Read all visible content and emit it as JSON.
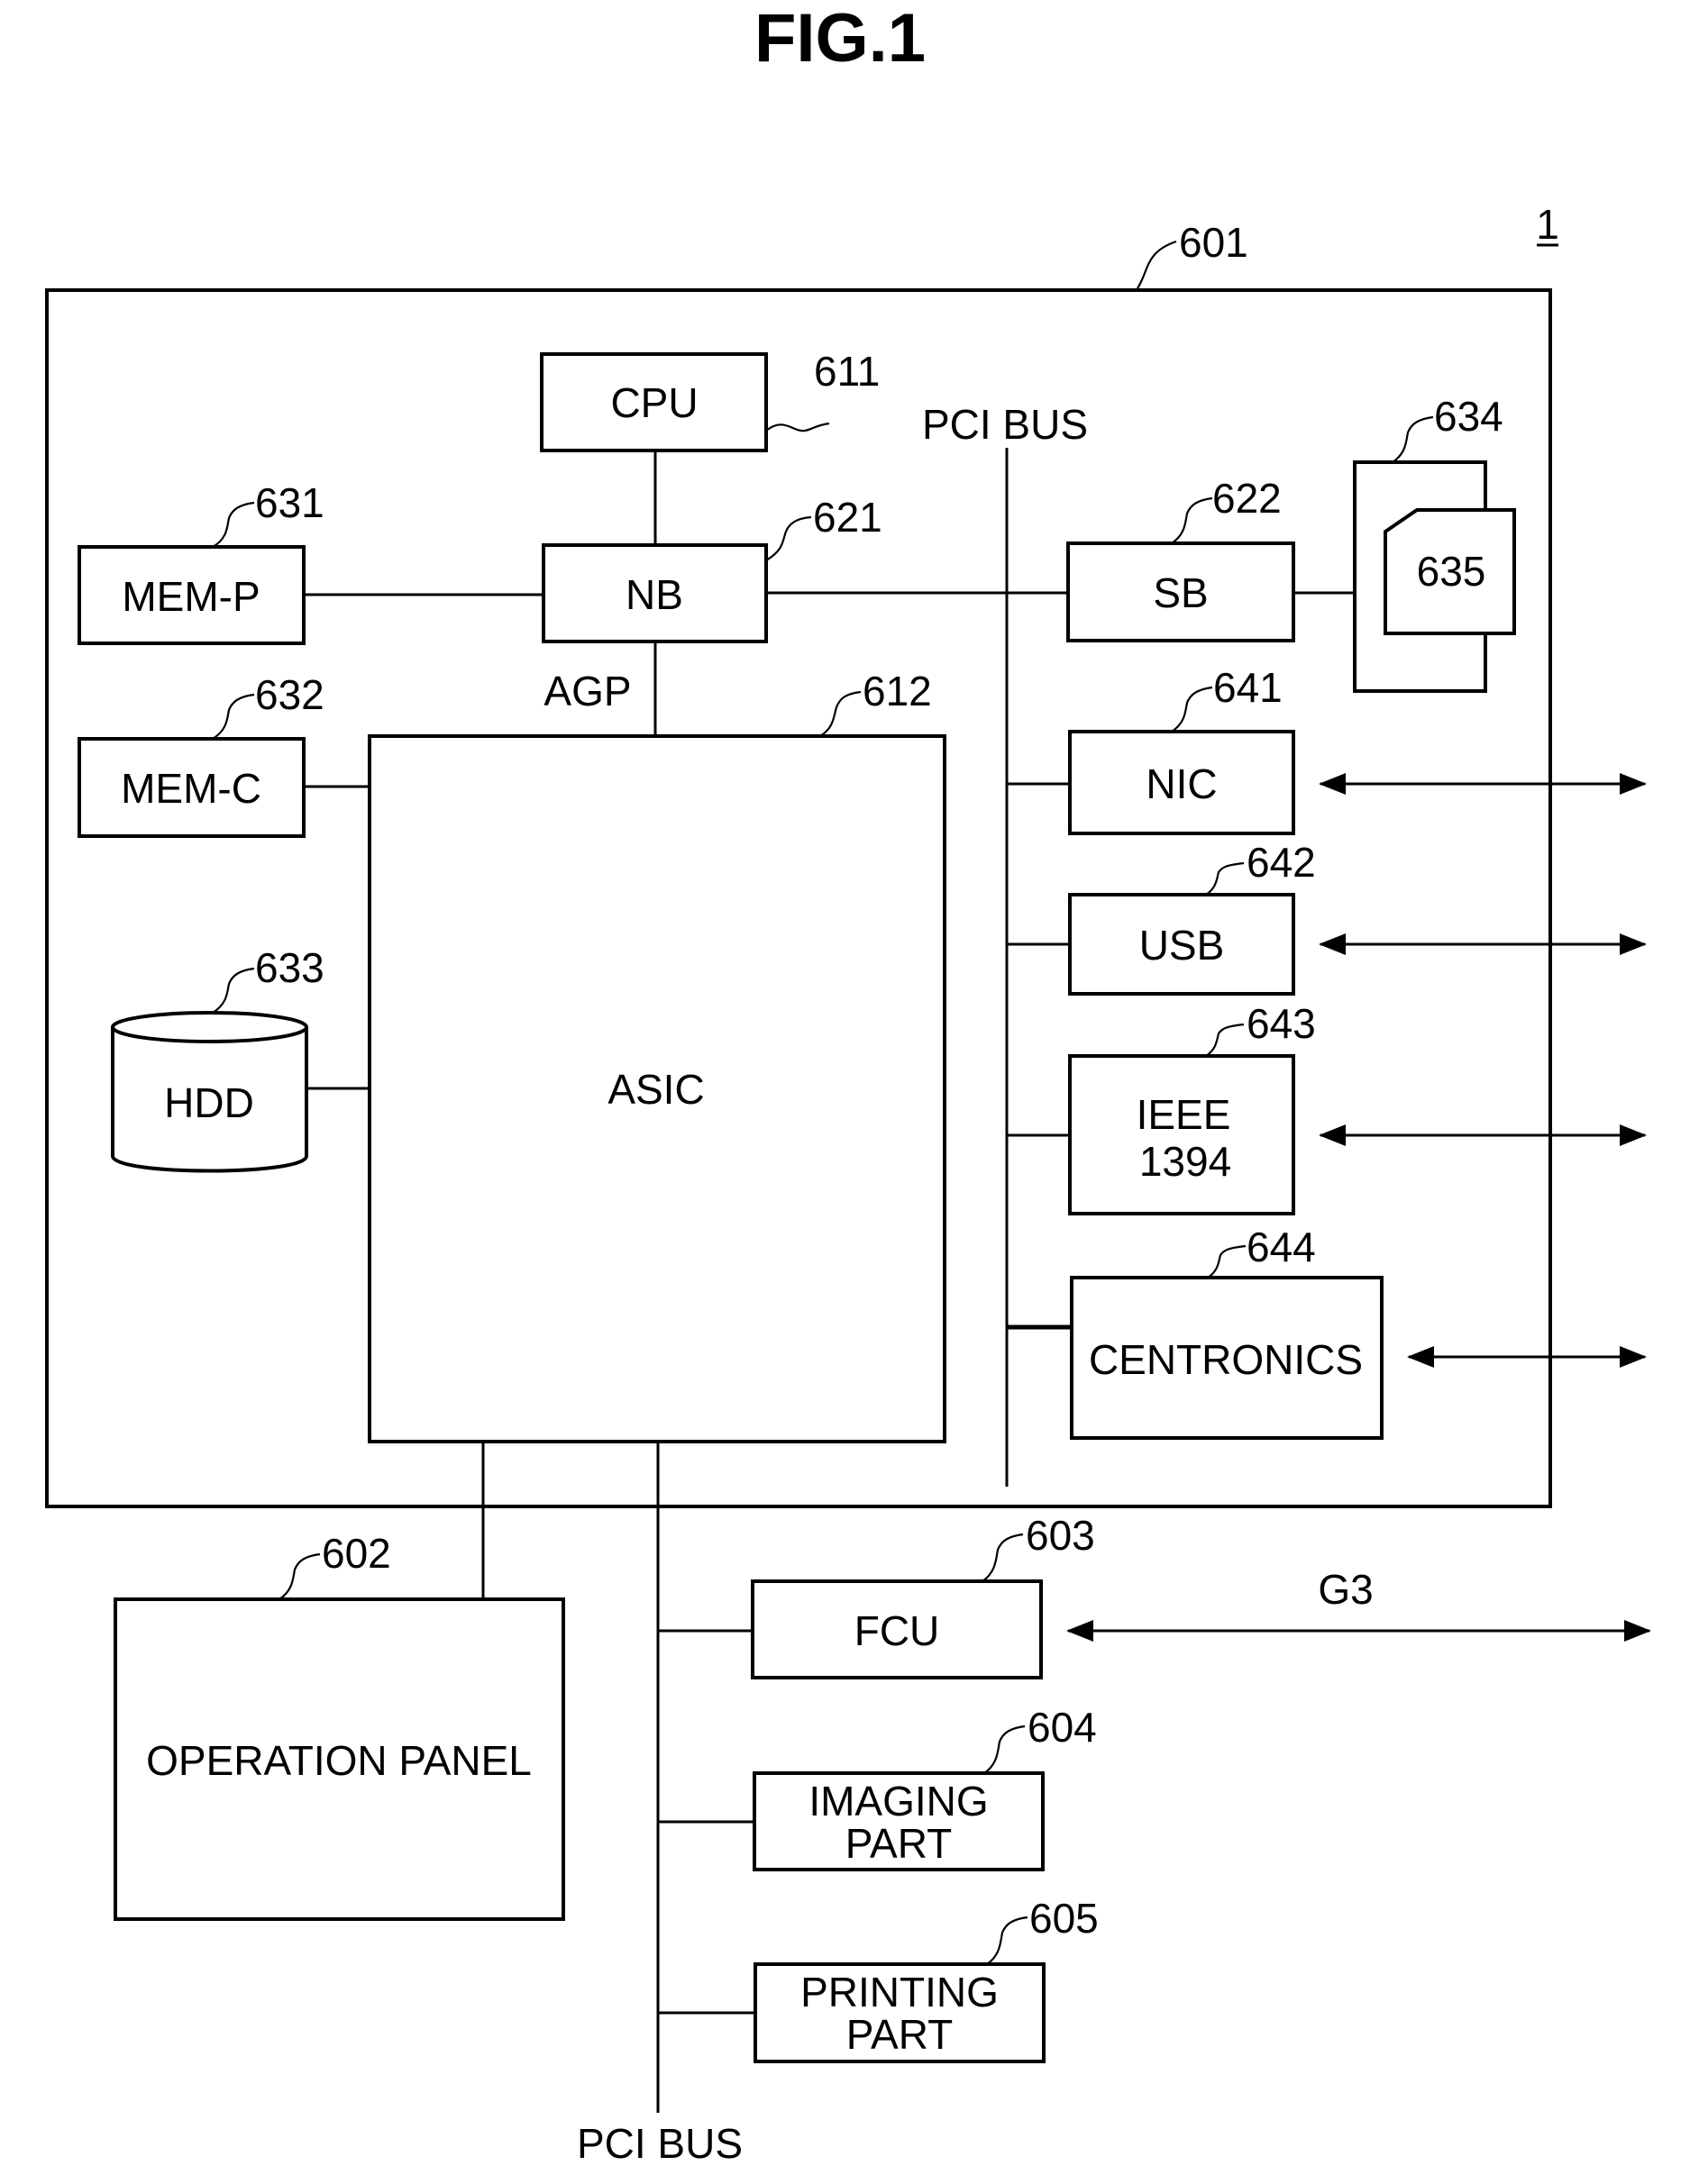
{
  "figure": {
    "title": "FIG.1",
    "device_ref": "1"
  },
  "controller": {
    "ref": "601"
  },
  "components": {
    "cpu": {
      "label": "CPU",
      "ref": "611"
    },
    "nb": {
      "label": "NB",
      "ref": "621"
    },
    "asic": {
      "label": "ASIC",
      "ref": "612"
    },
    "mem_p": {
      "label": "MEM-P",
      "ref": "631"
    },
    "mem_c": {
      "label": "MEM-C",
      "ref": "632"
    },
    "hdd": {
      "label": "HDD",
      "ref": "633"
    },
    "sb": {
      "label": "SB",
      "ref": "622"
    },
    "slot": {
      "ref": "634"
    },
    "card": {
      "label": "635"
    },
    "nic": {
      "label": "NIC",
      "ref": "641"
    },
    "usb": {
      "label": "USB",
      "ref": "642"
    },
    "ieee": {
      "label_line1": "IEEE",
      "label_line2": "1394",
      "ref": "643"
    },
    "centronics": {
      "label": "CENTRONICS",
      "ref": "644"
    },
    "operation_panel": {
      "label": "OPERATION PANEL",
      "ref": "602"
    },
    "fcu": {
      "label": "FCU",
      "ref": "603"
    },
    "imaging": {
      "label_line1": "IMAGING",
      "label_line2": "PART",
      "ref": "604"
    },
    "printing": {
      "label_line1": "PRINTING",
      "label_line2": "PART",
      "ref": "605"
    }
  },
  "buses": {
    "agp": "AGP",
    "pci_top": "PCI BUS",
    "pci_bottom": "PCI BUS",
    "g3": "G3"
  }
}
